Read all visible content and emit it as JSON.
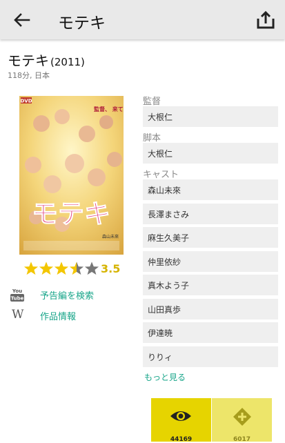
{
  "header": {
    "title": "モテキ",
    "back_icon": "arrow-left-icon",
    "share_icon": "share-icon"
  },
  "movie": {
    "title": "モテキ",
    "year": "(2011)",
    "meta": "118分, 日本",
    "rating_value": "3.5",
    "rating": 3.5,
    "rating_max": 5
  },
  "poster": {
    "title_text": "モテキ",
    "badge": "DVD",
    "tagline": "監督、\n来てきた！",
    "credit": "森山未來"
  },
  "links": {
    "trailer": "予告編を検索",
    "info": "作品情報",
    "youtube_icon_text": "You Tube",
    "wiki_icon_text": "W"
  },
  "credits": {
    "director_label": "監督",
    "director": "大根仁",
    "writer_label": "脚本",
    "writer": "大根仁",
    "cast_label": "キャスト",
    "cast": [
      "森山未來",
      "長澤まさみ",
      "麻生久美子",
      "仲里依紗",
      "真木よう子",
      "山田真歩",
      "伊達暁",
      "りりィ"
    ],
    "more": "もっと見る"
  },
  "stats": {
    "watched": "44169",
    "wish": "6017"
  },
  "colors": {
    "accent_green": "#17a589",
    "star_gold": "#f3c600",
    "watched_bg": "#e6d400",
    "wish_bg": "#ede56a"
  }
}
